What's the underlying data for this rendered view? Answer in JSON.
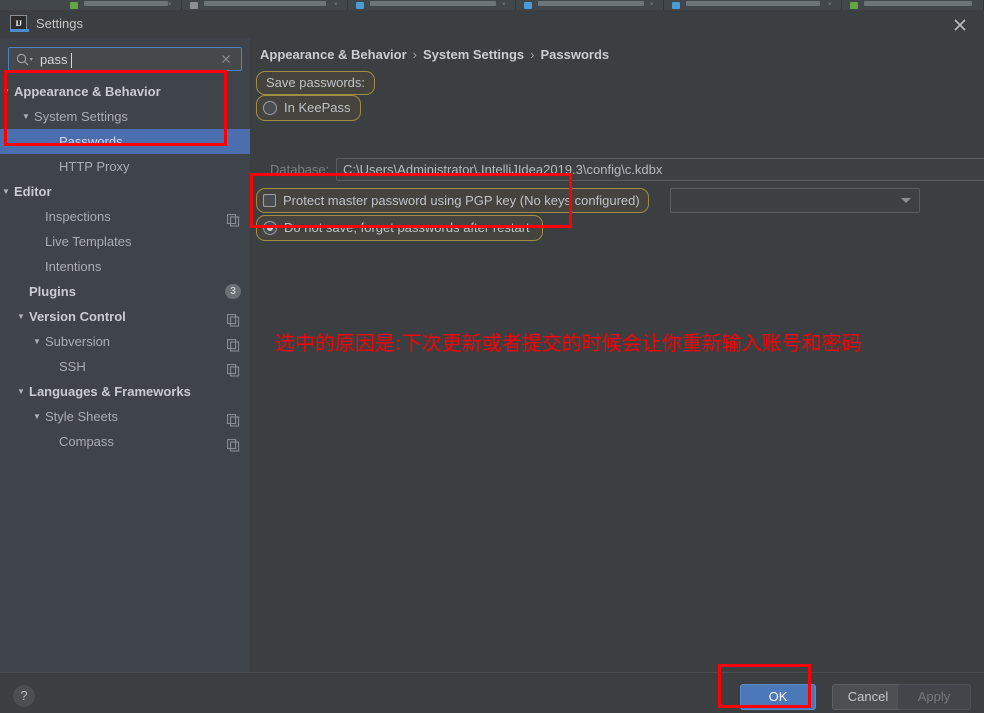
{
  "window": {
    "title": "Settings",
    "logo_text": "IJ",
    "close_icon": "close-icon"
  },
  "tabstrip": {
    "tabs": [
      {
        "title": ""
      },
      {
        "title": ""
      },
      {
        "title": ""
      },
      {
        "title": ""
      },
      {
        "title": ""
      },
      {
        "title": ""
      }
    ]
  },
  "search": {
    "value": "pass",
    "placeholder": "",
    "magnifier_icon": "search-icon",
    "clear_icon": "clear-icon"
  },
  "sidebar": {
    "items": [
      {
        "label": "Appearance & Behavior",
        "indent": 14,
        "arrow": "▼",
        "group": true,
        "selected": false,
        "right_icon": "",
        "badge": ""
      },
      {
        "label": "System Settings",
        "indent": 34,
        "arrow": "▼",
        "group": false,
        "selected": false,
        "right_icon": "",
        "badge": ""
      },
      {
        "label": "Passwords",
        "indent": 59,
        "arrow": "",
        "group": false,
        "selected": true,
        "right_icon": "",
        "badge": ""
      },
      {
        "label": "HTTP Proxy",
        "indent": 59,
        "arrow": "",
        "group": false,
        "selected": false,
        "right_icon": "",
        "badge": ""
      },
      {
        "label": "Editor",
        "indent": 14,
        "arrow": "▼",
        "group": true,
        "selected": false,
        "right_icon": "",
        "badge": ""
      },
      {
        "label": "Inspections",
        "indent": 45,
        "arrow": "",
        "group": false,
        "selected": false,
        "right_icon": "copy-icon",
        "badge": ""
      },
      {
        "label": "Live Templates",
        "indent": 45,
        "arrow": "",
        "group": false,
        "selected": false,
        "right_icon": "",
        "badge": ""
      },
      {
        "label": "Intentions",
        "indent": 45,
        "arrow": "",
        "group": false,
        "selected": false,
        "right_icon": "",
        "badge": ""
      },
      {
        "label": "Plugins",
        "indent": 29,
        "arrow": "",
        "group": true,
        "selected": false,
        "right_icon": "",
        "badge": "3"
      },
      {
        "label": "Version Control",
        "indent": 29,
        "arrow": "▼",
        "group": true,
        "selected": false,
        "right_icon": "copy-icon",
        "badge": ""
      },
      {
        "label": "Subversion",
        "indent": 45,
        "arrow": "▼",
        "group": false,
        "selected": false,
        "right_icon": "copy-icon",
        "badge": ""
      },
      {
        "label": "SSH",
        "indent": 59,
        "arrow": "",
        "group": false,
        "selected": false,
        "right_icon": "copy-icon",
        "badge": ""
      },
      {
        "label": "Languages & Frameworks",
        "indent": 29,
        "arrow": "▼",
        "group": true,
        "selected": false,
        "right_icon": "",
        "badge": ""
      },
      {
        "label": "Style Sheets",
        "indent": 45,
        "arrow": "▼",
        "group": false,
        "selected": false,
        "right_icon": "copy-icon",
        "badge": ""
      },
      {
        "label": "Compass",
        "indent": 59,
        "arrow": "",
        "group": false,
        "selected": false,
        "right_icon": "copy-icon",
        "badge": ""
      }
    ]
  },
  "breadcrumb": {
    "part1": "Appearance & Behavior",
    "sep1": "›",
    "part2": "System Settings",
    "sep2": "›",
    "part3": "Passwords"
  },
  "main": {
    "save_passwords_label": "Save passwords:",
    "keepass_label": "In KeePass",
    "keepass_selected": false,
    "database_label": "Database:",
    "database_value": "C:\\Users\\Administrator\\.IntelliJIdea2019.3\\config\\c.kdbx",
    "database_folder_icon": "folder-icon",
    "database_gear_icon": "gear-icon",
    "pgp_label": "Protect master password using PGP key (No keys configured)",
    "pgp_checked": false,
    "pgp_select_value": "",
    "donotsave_label": "Do not save, forget passwords after restart",
    "donotsave_selected": true,
    "annotation": "选中的原因是:下次更新或者提交的时候会让你重新输入账号和密码"
  },
  "bottom": {
    "help_label": "?",
    "ok_label": "OK",
    "cancel_label": "Cancel",
    "apply_label": "Apply"
  },
  "colors": {
    "accent_blue": "#4b6eaf",
    "ok_button": "#4a78b8",
    "highlight_border": "#9e8d43",
    "annotation_red": "#ff0000",
    "window_bg": "#3c3f41",
    "sidebar_bg": "#3f434a"
  }
}
